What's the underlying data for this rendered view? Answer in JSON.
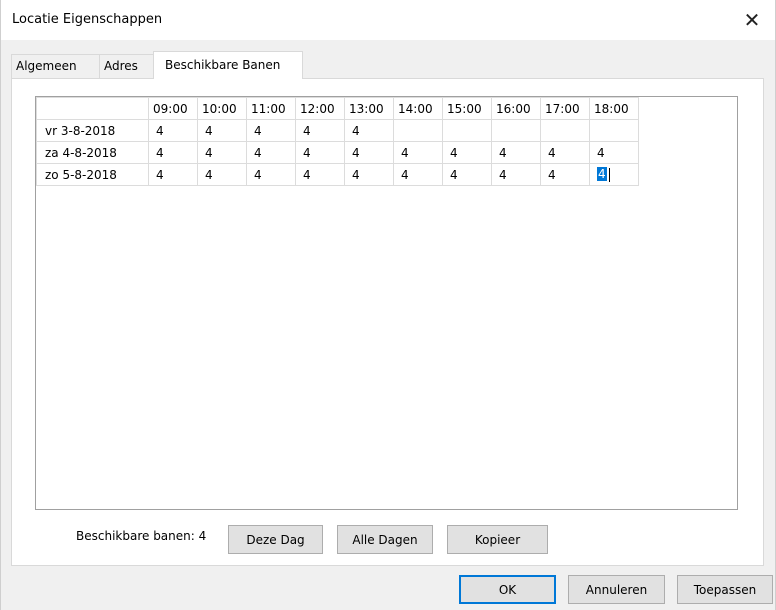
{
  "window": {
    "title": "Locatie Eigenschappen",
    "close_glyph": "✕"
  },
  "tabs": [
    {
      "label": "Algemeen",
      "active": false
    },
    {
      "label": "Adres",
      "active": false
    },
    {
      "label": "Beschikbare Banen",
      "active": true
    }
  ],
  "grid": {
    "columns": [
      "09:00",
      "10:00",
      "11:00",
      "12:00",
      "13:00",
      "14:00",
      "15:00",
      "16:00",
      "17:00",
      "18:00"
    ],
    "rows": [
      {
        "label": "vr 3-8-2018",
        "values": [
          "4",
          "4",
          "4",
          "4",
          "4",
          "",
          "",
          "",
          "",
          ""
        ]
      },
      {
        "label": "za 4-8-2018",
        "values": [
          "4",
          "4",
          "4",
          "4",
          "4",
          "4",
          "4",
          "4",
          "4",
          "4"
        ]
      },
      {
        "label": "zo 5-8-2018",
        "values": [
          "4",
          "4",
          "4",
          "4",
          "4",
          "4",
          "4",
          "4",
          "4",
          "4"
        ]
      }
    ],
    "selected_cell": {
      "row": 2,
      "col": 9
    }
  },
  "footer": {
    "count_label": "Beschikbare banen: 4",
    "deze_dag_label": "Deze Dag",
    "alle_dagen_label": "Alle Dagen",
    "kopieer_label": "Kopieer"
  },
  "dialog_buttons": {
    "ok_label": "OK",
    "cancel_label": "Annuleren",
    "apply_label": "Toepassen"
  },
  "colors": {
    "selection": "#0078d7",
    "default_button_border": "#0078d7"
  }
}
